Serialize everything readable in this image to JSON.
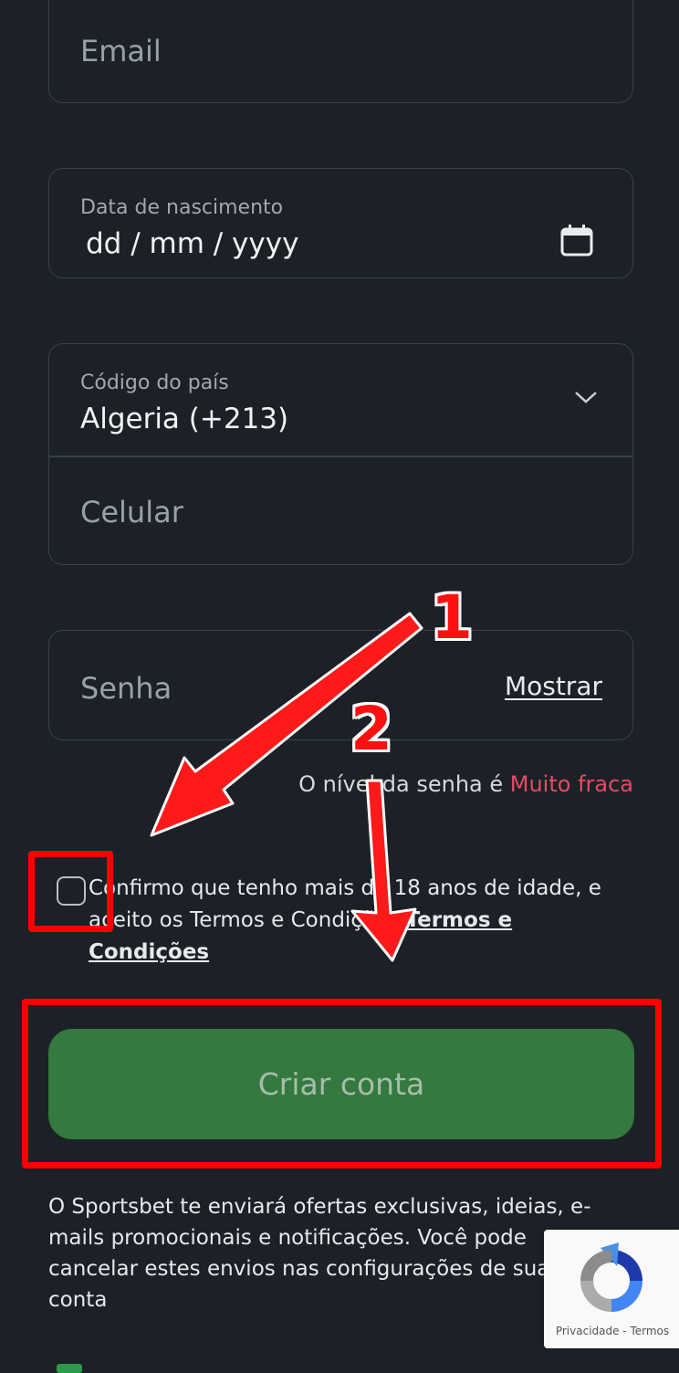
{
  "form": {
    "email_placeholder": "Email",
    "dob_label": "Data de nascimento",
    "dob_value": "dd / mm / yyyy",
    "country_label": "Código do país",
    "country_value": "Algeria (+213)",
    "phone_placeholder": "Celular",
    "password_placeholder": "Senha",
    "show_label": "Mostrar",
    "strength_prefix": "O nível da senha é ",
    "strength_value": "Muito fraca",
    "terms_text": "Confirmo que tenho mais de 18 anos de idade, e aceito os Termos e Condições ",
    "terms_link": "Termos e Condições",
    "submit_label": "Criar conta",
    "info_text": "O Sportsbet te enviará ofertas exclusivas, ideias, e-mails promocionais e notificações. Você pode cancelar estes envios nas configurações de sua conta"
  },
  "annotations": {
    "step1": "1",
    "step2": "2"
  },
  "recaptcha": {
    "label": "Privacidade - Termos"
  },
  "colors": {
    "background": "#1c2127",
    "button": "#34793f",
    "weak": "#e54b64",
    "annotation": "#ff0000"
  }
}
